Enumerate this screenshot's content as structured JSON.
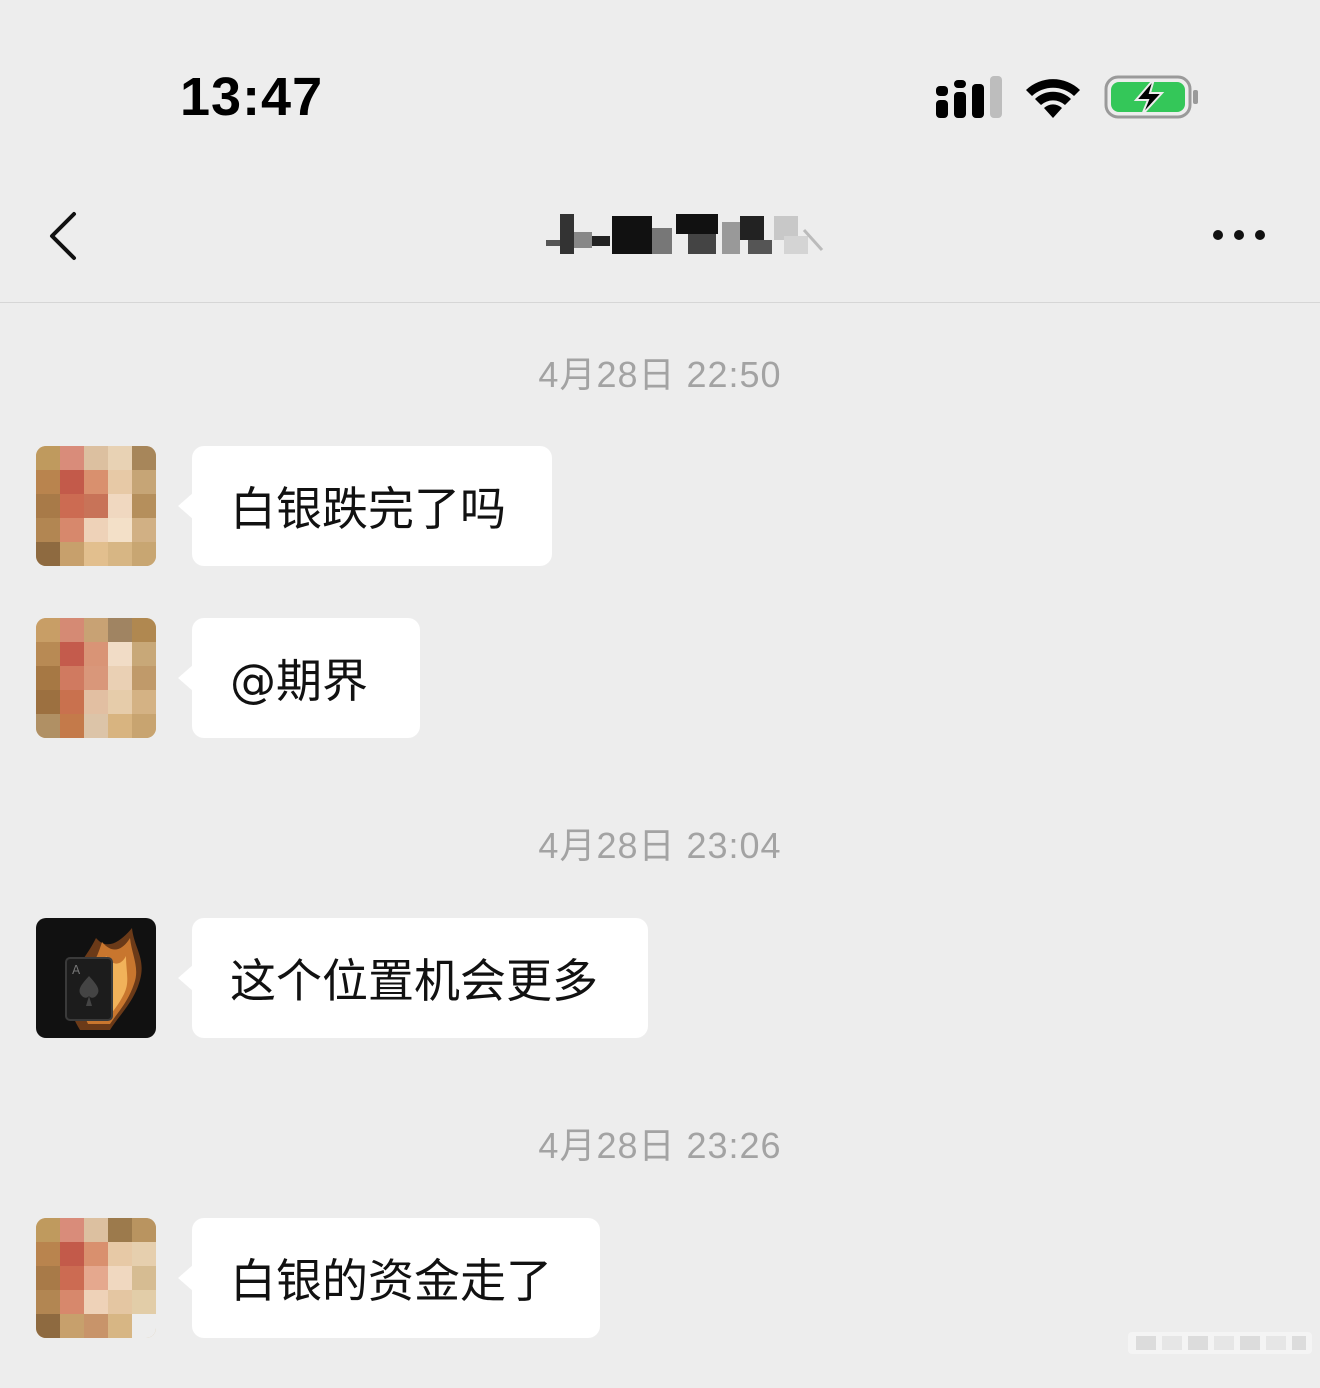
{
  "status_bar": {
    "time": "13:47",
    "signal_icon": "signal-strength-icon",
    "wifi_icon": "wifi-icon",
    "battery_icon": "battery-charging-icon",
    "battery_color": "#34c759"
  },
  "nav": {
    "back_icon": "chevron-left-icon",
    "title_pixelated": true,
    "more_icon": "more-dots-icon"
  },
  "chat": {
    "timestamps": [
      "4月28日 22:50",
      "4月28日 23:04",
      "4月28日 23:26"
    ],
    "messages": [
      {
        "text": "白银跌完了吗"
      },
      {
        "text": "@期界"
      },
      {
        "text": "这个位置机会更多"
      },
      {
        "text": "白银的资金走了"
      }
    ]
  },
  "colors": {
    "background": "#ededed",
    "bubble": "#ffffff",
    "timestamp": "#a3a3a3"
  }
}
